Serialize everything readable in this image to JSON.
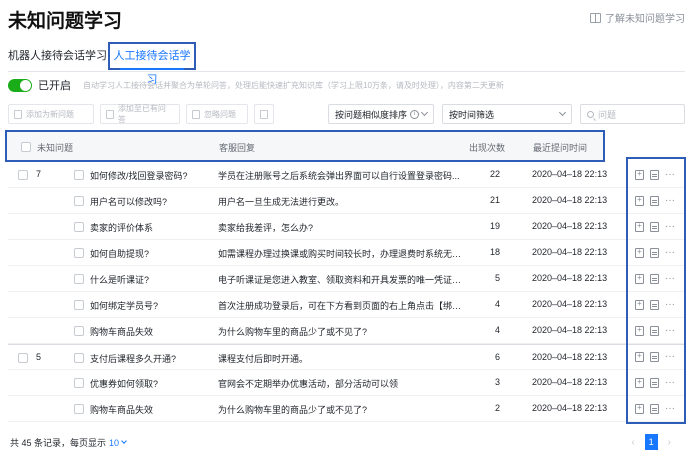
{
  "header": {
    "title": "未知问题学习",
    "help_link": "了解未知问题学习"
  },
  "tabs": [
    {
      "label": "机器人接待会话学习",
      "active": false
    },
    {
      "label": "人工接待会话学习",
      "active": true
    }
  ],
  "toggle": {
    "label": "已开启",
    "on": true,
    "description": "自动学习人工接待会话并聚合为单轮问答，处理后能快速扩充知识库（学习上限10万条，请及时处理），内容第二天更新"
  },
  "toolbar": {
    "add_new": "添加为新问题",
    "add_existing": "添加至已有问答",
    "ignore": "忽略问题",
    "sort_select": "按问题相似度排序",
    "time_select": "按时间筛选",
    "search_placeholder": "问题"
  },
  "table": {
    "headers": {
      "question": "未知问题",
      "answer": "客服回复",
      "count": "出现次数",
      "time": "最近提问时间"
    },
    "rows": [
      {
        "group": "7",
        "question": "如何修改/找回登录密码?",
        "answer": "学员在注册账号之后系统会弹出界面可以自行设置登录密码...",
        "count": "22",
        "time": "2020–04–18 22:13"
      },
      {
        "group": "",
        "question": "用户名可以修改吗?",
        "answer": "用户名一旦生成无法进行更改。",
        "count": "21",
        "time": "2020–04–18 22:13"
      },
      {
        "group": "",
        "question": "卖家的评价体系",
        "answer": "卖家给我差评，怎么办?",
        "count": "19",
        "time": "2020–04–18 22:13"
      },
      {
        "group": "",
        "question": "如何自助提现?",
        "answer": "如需课程办理过换课或购买时间较长时，办理退费时系统无法原路退回...",
        "count": "18",
        "time": "2020–04–18 22:13"
      },
      {
        "group": "",
        "question": "什么是听课证?",
        "answer": "电子听课证是您进入教室、领取资料和开具发票的唯一凭证。所以在报...",
        "count": "5",
        "time": "2020–04–18 22:13"
      },
      {
        "group": "",
        "question": "如何绑定学员号?",
        "answer": "首次注册成功登录后，可在下方看到页面的右上角点击【绑定学员号】...",
        "count": "4",
        "time": "2020–04–18 22:13"
      },
      {
        "group": "",
        "question": "购物车商品失效",
        "answer": "为什么购物车里的商品少了或不见了?",
        "count": "4",
        "time": "2020–04–18 22:13"
      },
      {
        "group": "5",
        "question": "支付后课程多久开通?",
        "answer": "课程支付后即时开通。",
        "count": "6",
        "time": "2020–04–18 22:13"
      },
      {
        "group": "",
        "question": "优惠券如何领取?",
        "answer": "官网会不定期举办优惠活动，部分活动可以领",
        "count": "3",
        "time": "2020–04–18 22:13"
      },
      {
        "group": "",
        "question": "购物车商品失效",
        "answer": "为什么购物车里的商品少了或不见了?",
        "count": "2",
        "time": "2020–04–18 22:13"
      }
    ]
  },
  "footer": {
    "total_text": "共 45 条记录，每页显示",
    "page_size": "10",
    "current_page": "1"
  }
}
